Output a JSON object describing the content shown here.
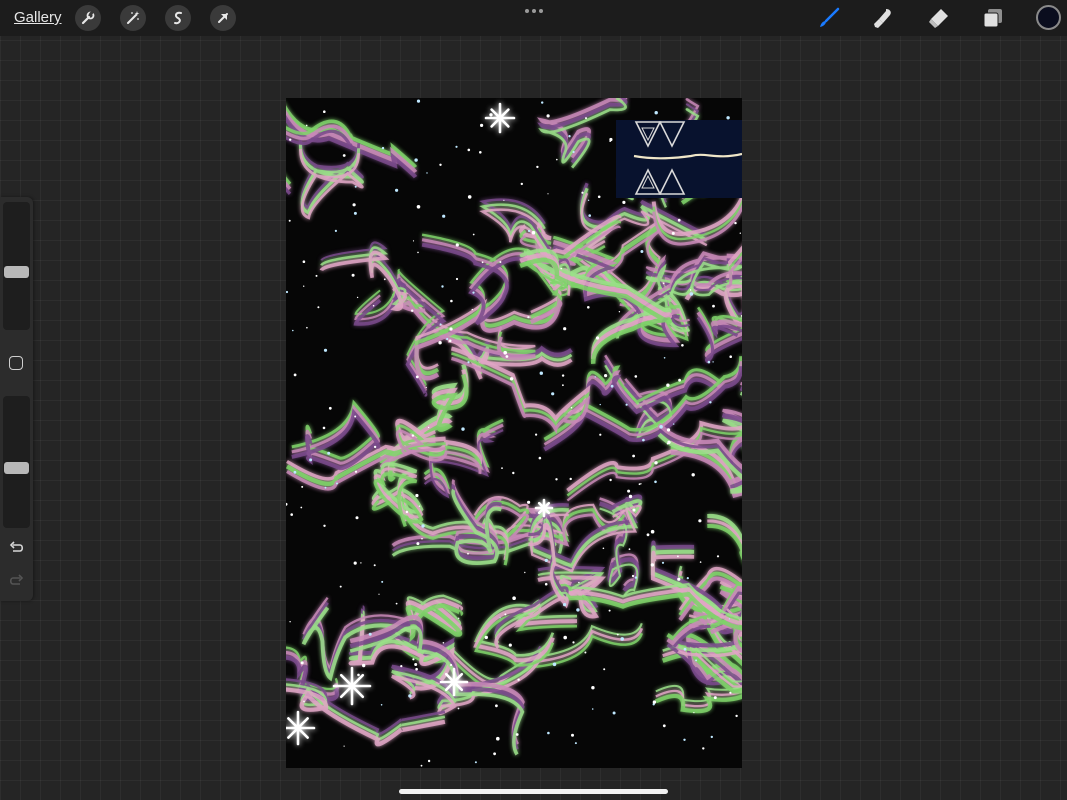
{
  "topbar": {
    "gallery_label": "Gallery",
    "left_tools": [
      "actions-wrench",
      "adjustments-wand",
      "selection-s",
      "transform-arrow"
    ],
    "right_tools": [
      "brush",
      "smudge",
      "eraser",
      "layers"
    ],
    "active_tool": "brush"
  },
  "colors": {
    "accent": "#1a7bff",
    "current_color": "#0a0d1e",
    "canvas_background": "#060606",
    "stroke_green": "#7fd36a",
    "stroke_pink": "#c98ab8",
    "stroke_purple": "#7a4a8c",
    "inset_panel": "#08122e"
  },
  "sidebar": {
    "brush_size_level": 0.55,
    "opacity_level": 0.55,
    "undo_icon": "undo-arrow",
    "redo_icon": "redo-arrow"
  },
  "canvas": {
    "content": "artwork"
  }
}
